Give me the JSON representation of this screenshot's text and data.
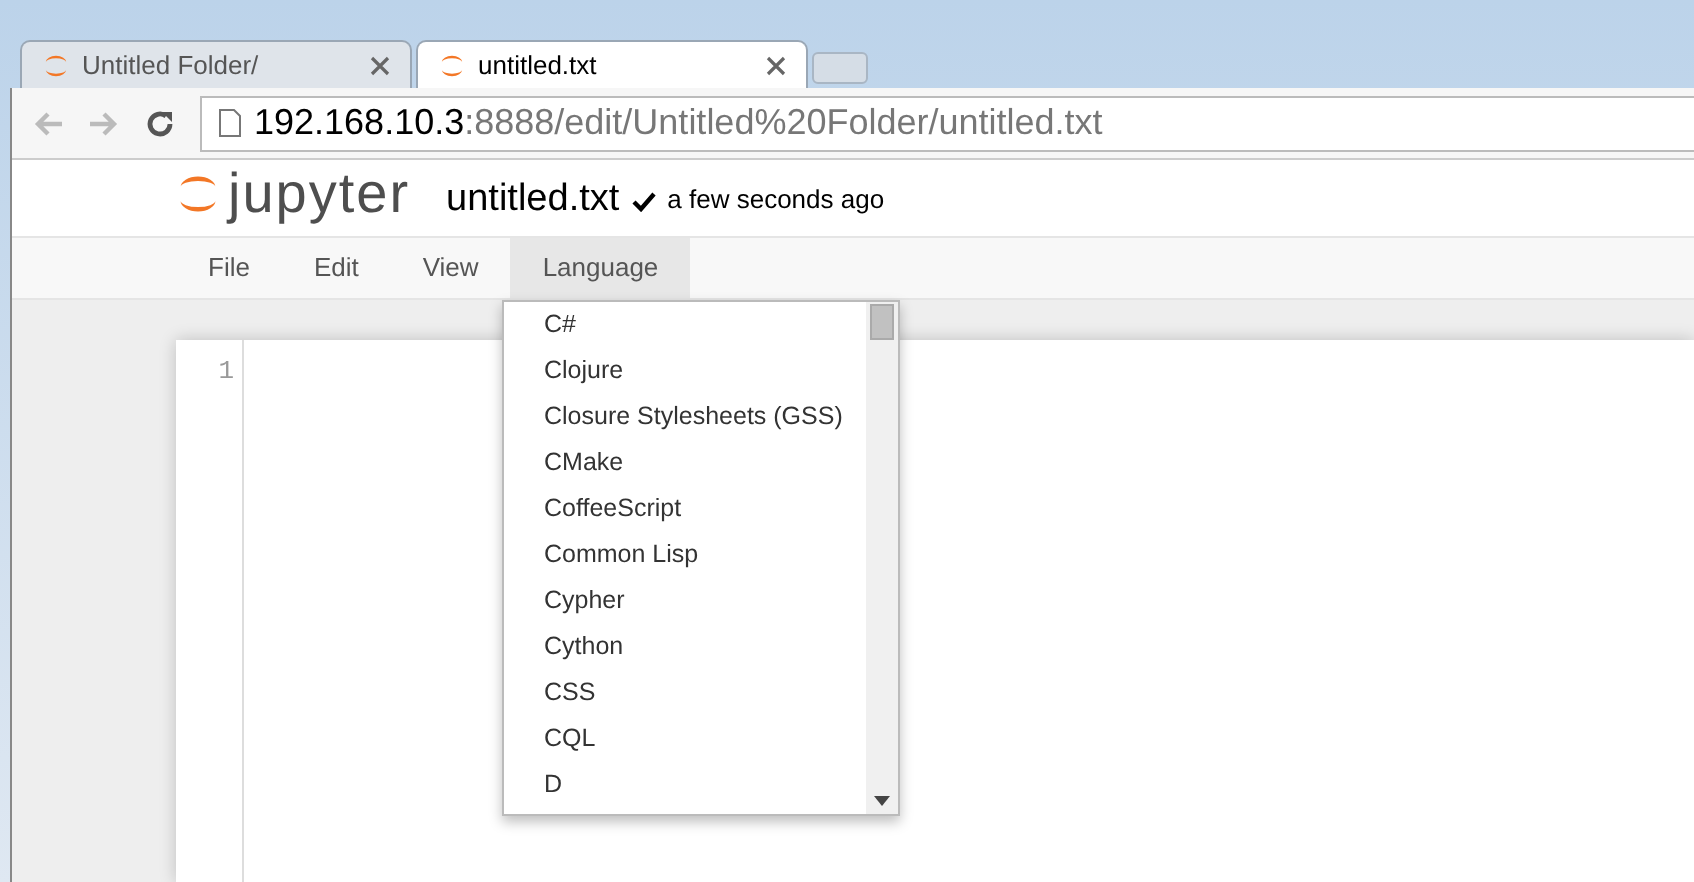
{
  "browser_tabs": [
    {
      "title": "Untitled Folder/",
      "selected": false
    },
    {
      "title": "untitled.txt",
      "selected": true
    }
  ],
  "address_bar": {
    "host": "192.168.10.3",
    "path": ":8888/edit/Untitled%20Folder/untitled.txt"
  },
  "header": {
    "logo_text": "jupyter",
    "filename": "untitled.txt",
    "save_status": "a few seconds ago"
  },
  "menu": [
    {
      "label": "File",
      "selected": false
    },
    {
      "label": "Edit",
      "selected": false
    },
    {
      "label": "View",
      "selected": false
    },
    {
      "label": "Language",
      "selected": true
    }
  ],
  "language_dropdown": [
    "C#",
    "Clojure",
    "Closure Stylesheets (GSS)",
    "CMake",
    "CoffeeScript",
    "Common Lisp",
    "Cypher",
    "Cython",
    "CSS",
    "CQL",
    "D"
  ],
  "editor": {
    "line_numbers": [
      "1"
    ]
  }
}
